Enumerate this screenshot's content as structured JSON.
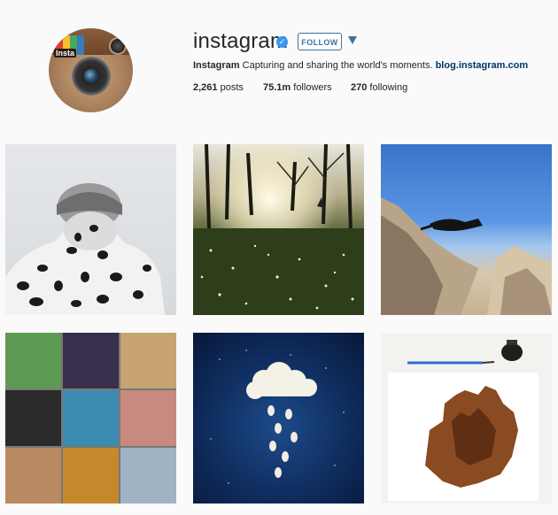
{
  "profile": {
    "username": "instagram",
    "verified_icon": "verified-badge-icon",
    "follow_label": "FOLLOW",
    "avatar_label": "Insta",
    "bio_name": "Instagram",
    "bio_text": " Capturing and sharing the world's moments. ",
    "bio_link": "blog.instagram.com"
  },
  "stats": {
    "posts_count": "2,261",
    "posts_label": " posts",
    "followers_count": "75.1m",
    "followers_label": " followers",
    "following_count": "270",
    "following_label": " following"
  },
  "colors": {
    "accent": "#3f729b",
    "verified": "#3897f0",
    "link": "#003569"
  },
  "posts": [
    {
      "name": "post-spotted-jacket"
    },
    {
      "name": "post-forest-sunlight"
    },
    {
      "name": "post-cat-leaping-rocks"
    },
    {
      "name": "post-photo-collage"
    },
    {
      "name": "post-cloud-rain-illustration"
    },
    {
      "name": "post-ink-city-painting"
    }
  ]
}
